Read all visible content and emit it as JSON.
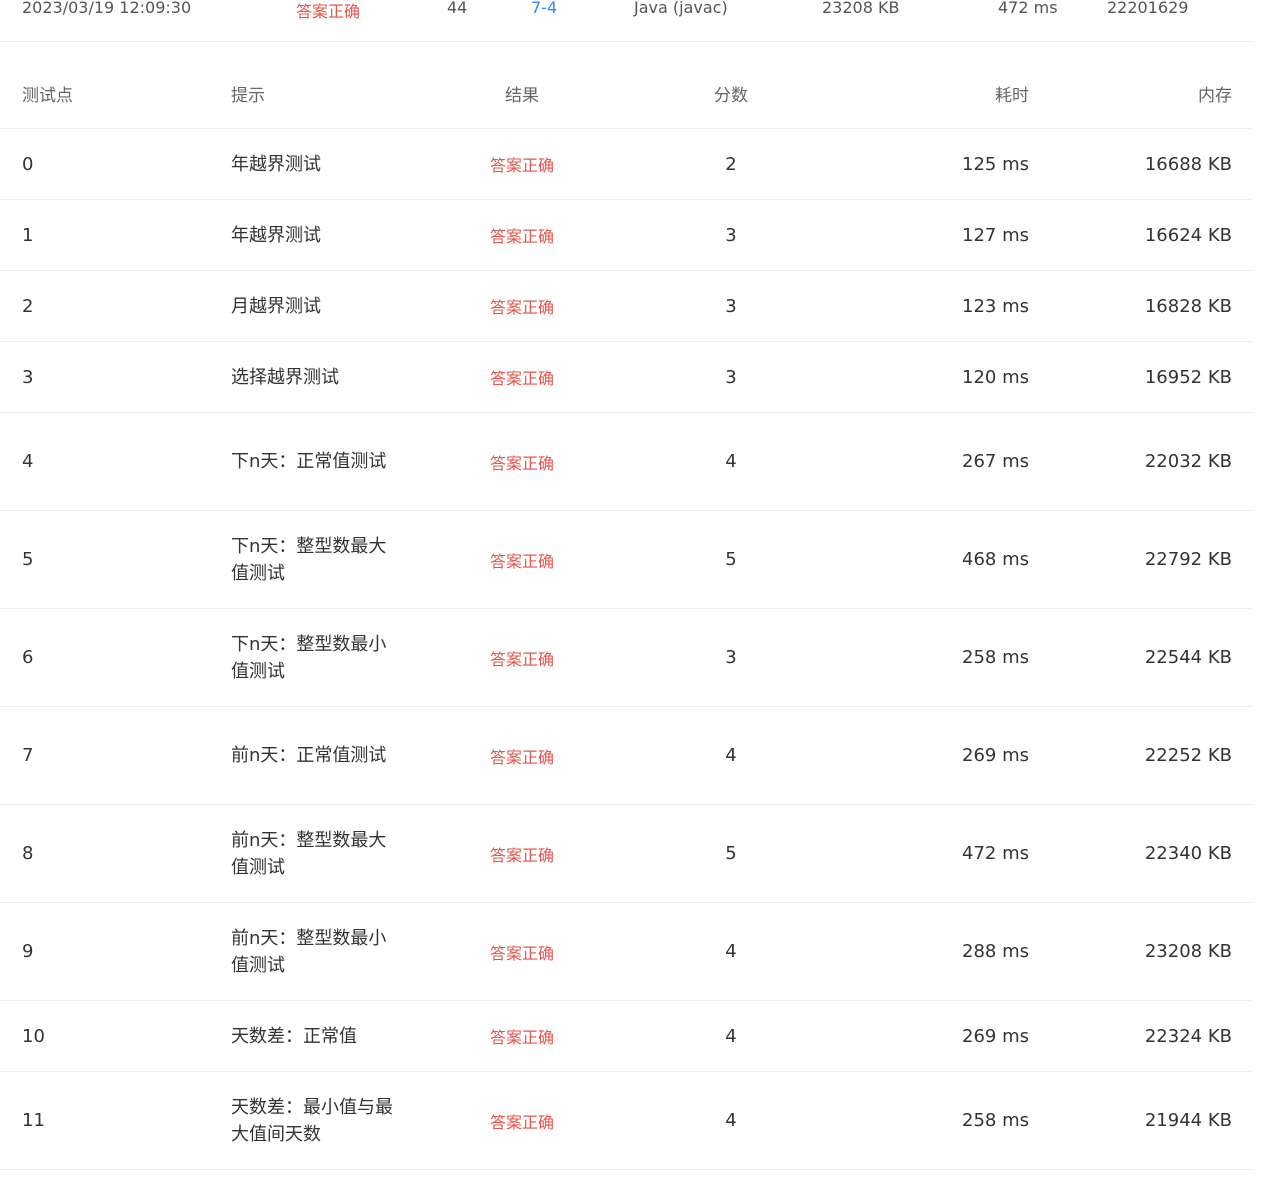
{
  "summary": {
    "time": "2023/03/19 12:09:30",
    "status": "答案正确",
    "score": "44",
    "problem": "7-4",
    "compiler": "Java (javac)",
    "memory": "23208 KB",
    "duration": "472 ms",
    "user": "22201629"
  },
  "table": {
    "headers": {
      "id": "测试点",
      "hint": "提示",
      "result": "结果",
      "score": "分数",
      "time": "耗时",
      "memory": "内存"
    },
    "rows": [
      {
        "id": "0",
        "hint": "年越界测试",
        "result": "答案正确",
        "score": "2",
        "time": "125 ms",
        "memory": "16688 KB"
      },
      {
        "id": "1",
        "hint": "年越界测试",
        "result": "答案正确",
        "score": "3",
        "time": "127 ms",
        "memory": "16624 KB"
      },
      {
        "id": "2",
        "hint": "月越界测试",
        "result": "答案正确",
        "score": "3",
        "time": "123 ms",
        "memory": "16828 KB"
      },
      {
        "id": "3",
        "hint": "选择越界测试",
        "result": "答案正确",
        "score": "3",
        "time": "120 ms",
        "memory": "16952 KB"
      },
      {
        "id": "4",
        "hint": "下n天：正常值测试",
        "result": "答案正确",
        "score": "4",
        "time": "267 ms",
        "memory": "22032 KB"
      },
      {
        "id": "5",
        "hint": "下n天：整型数最大值测试",
        "result": "答案正确",
        "score": "5",
        "time": "468 ms",
        "memory": "22792 KB"
      },
      {
        "id": "6",
        "hint": "下n天：整型数最小值测试",
        "result": "答案正确",
        "score": "3",
        "time": "258 ms",
        "memory": "22544 KB"
      },
      {
        "id": "7",
        "hint": "前n天：正常值测试",
        "result": "答案正确",
        "score": "4",
        "time": "269 ms",
        "memory": "22252 KB"
      },
      {
        "id": "8",
        "hint": "前n天：整型数最大值测试",
        "result": "答案正确",
        "score": "5",
        "time": "472 ms",
        "memory": "22340 KB"
      },
      {
        "id": "9",
        "hint": "前n天：整型数最小值测试",
        "result": "答案正确",
        "score": "4",
        "time": "288 ms",
        "memory": "23208 KB"
      },
      {
        "id": "10",
        "hint": "天数差：正常值",
        "result": "答案正确",
        "score": "4",
        "time": "269 ms",
        "memory": "22324 KB"
      },
      {
        "id": "11",
        "hint": "天数差：最小值与最大值间天数",
        "result": "答案正确",
        "score": "4",
        "time": "258 ms",
        "memory": "21944 KB"
      }
    ]
  },
  "colors": {
    "accepted": "#e8534a",
    "link": "#2d8cf0",
    "border": "#ebeef5"
  }
}
